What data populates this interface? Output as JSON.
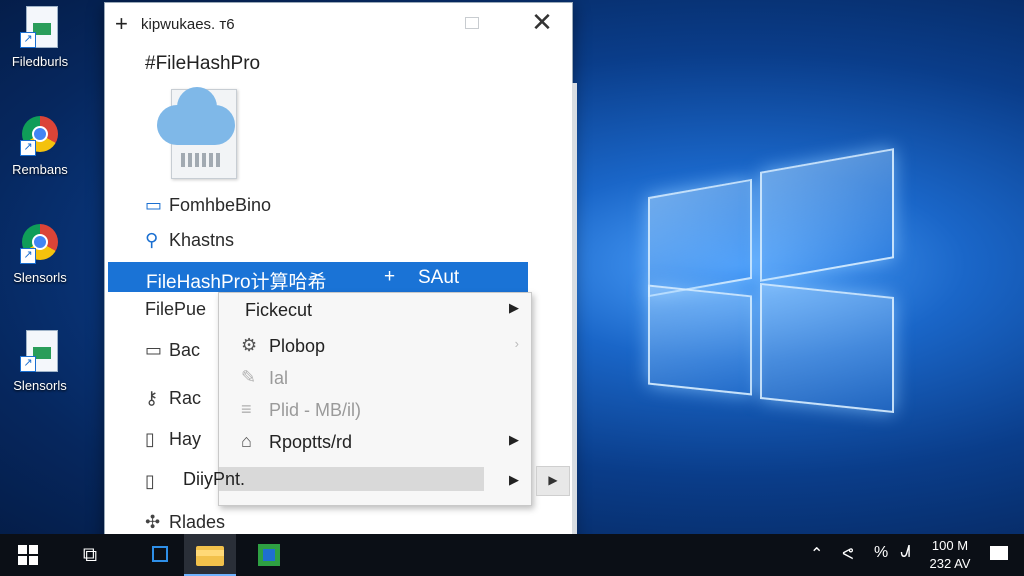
{
  "desktop": {
    "icons": [
      {
        "label": "Filedburls",
        "kind": "document"
      },
      {
        "label": "Rembans",
        "kind": "chrome"
      },
      {
        "label": "Slensorls",
        "kind": "chrome"
      },
      {
        "label": "Slensorls",
        "kind": "document"
      }
    ]
  },
  "dialog": {
    "title_prefix": "+",
    "title": "kipwukaes. т6",
    "close_glyph": "✕",
    "app_name": "#FileHashPro",
    "rows": [
      {
        "label": "FomhbeBino",
        "icon": "monitor-icon"
      },
      {
        "label": "Khastns",
        "icon": "tool-icon"
      },
      {
        "label": "FilePue",
        "icon": ""
      },
      {
        "label": "Bac",
        "icon": "drive-icon"
      },
      {
        "label": "Rac",
        "icon": "key-icon"
      },
      {
        "label": "Hay",
        "icon": "book-icon"
      },
      {
        "label": "",
        "icon": "book-icon"
      },
      {
        "label": "Rlades",
        "icon": "puzzle-icon"
      }
    ]
  },
  "context_menu": {
    "highlight": {
      "label": "FileHashPro计算哈希",
      "plus": "+",
      "action": "SAut"
    },
    "submenu": [
      {
        "label": "Fickecut",
        "icon": "",
        "arrow": "▶",
        "state": "normal"
      },
      {
        "label": "Plobop",
        "icon": "gear-icon",
        "arrow": "›",
        "state": "normal"
      },
      {
        "label": "Ial",
        "icon": "pencil-icon",
        "arrow": "",
        "state": "dim"
      },
      {
        "label": "Plid - MB/il)",
        "icon": "lines-icon",
        "arrow": "",
        "state": "dim"
      },
      {
        "label": "Rpoptts/rd",
        "icon": "home-icon",
        "arrow": "▶",
        "state": "normal"
      },
      {
        "label": "DiiyPnt.",
        "icon": "",
        "arrow": "▶",
        "state": "selected"
      }
    ],
    "more_glyph": "▶"
  },
  "taskbar": {
    "clock_time": "100 M",
    "clock_date": "232 AV",
    "tray_glyphs": [
      "⌃",
      "ᕙ",
      "%",
      "ᗂ"
    ]
  },
  "colors": {
    "accent": "#1a73d6",
    "taskbar": "#0b0f16",
    "desktop": "#0a3d8a"
  }
}
